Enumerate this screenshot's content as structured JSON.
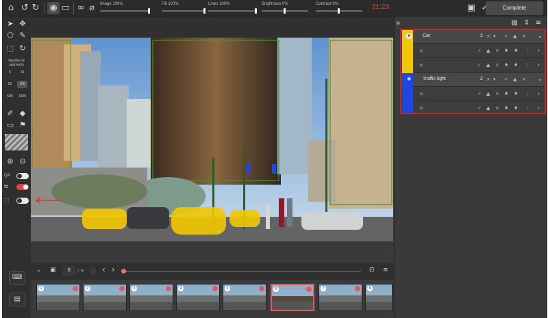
{
  "toolbar": {
    "sliders": [
      {
        "label": "Image 100%",
        "value": 1.0
      },
      {
        "label": "Fill 100%",
        "value": 1.0
      },
      {
        "label": "Lines 100%",
        "value": 1.0
      },
      {
        "label": "Brightness 0%",
        "value": 0.5
      },
      {
        "label": "Contrast 0%",
        "value": 0.5
      }
    ],
    "timer": "21:29",
    "complete_label": "Complete"
  },
  "tools": {
    "segments_title": "Number of segments",
    "segment_options": [
      "5",
      "15",
      "50",
      "150",
      "500",
      "1500"
    ],
    "segment_selected": "150",
    "qa_label": "QA",
    "toggles": [
      {
        "name": "qa",
        "on": false
      },
      {
        "name": "overlay",
        "on": true
      },
      {
        "name": "bbox",
        "on": false
      }
    ]
  },
  "classes": [
    {
      "name": "Car",
      "count": "2",
      "color": "#f2c800"
    },
    {
      "name": "Traffic light",
      "count": "2",
      "color": "#1f46e0"
    }
  ],
  "bottom": {
    "frame": "6",
    "total": "/ 9"
  },
  "thumbnails": [
    {
      "n": "1"
    },
    {
      "n": "2"
    },
    {
      "n": "3"
    },
    {
      "n": "4"
    },
    {
      "n": "5"
    },
    {
      "n": "6"
    },
    {
      "n": "7"
    },
    {
      "n": "8"
    }
  ],
  "colors": {
    "accent_red": "#c4262e",
    "car": "#f2c800",
    "traffic_light": "#1f46e0"
  }
}
